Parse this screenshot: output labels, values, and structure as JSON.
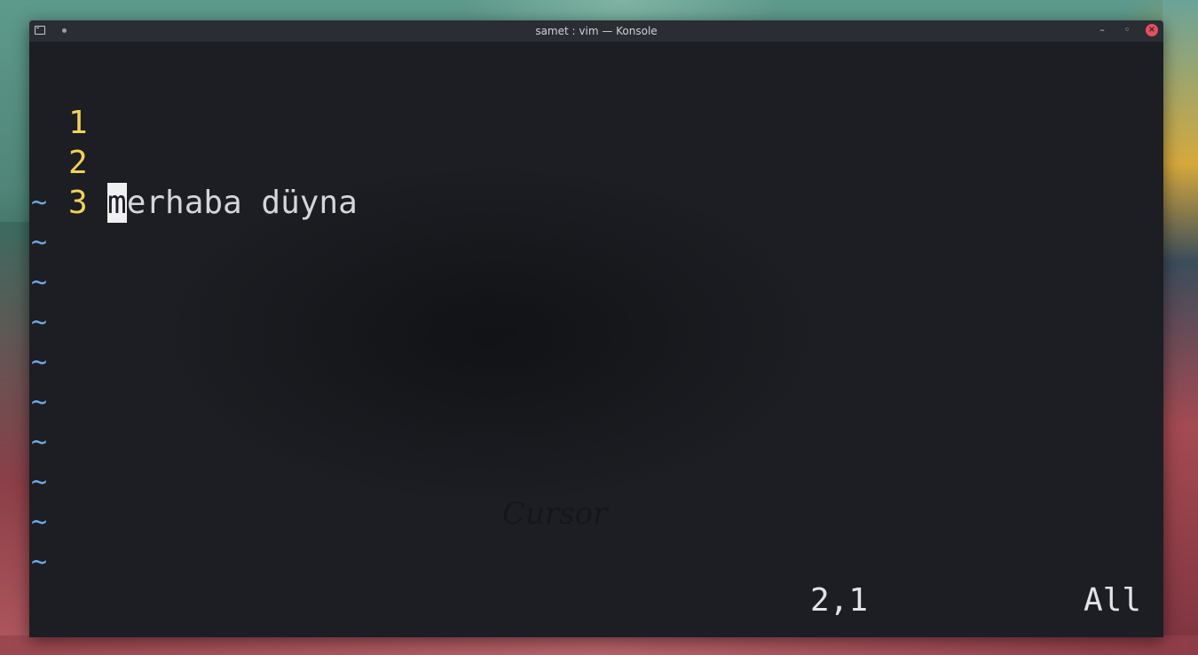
{
  "window": {
    "title": "samet : vim — Konsole",
    "controls": {
      "minimize": "–",
      "maximize": "◦",
      "close": "×"
    }
  },
  "editor": {
    "lines": [
      {
        "number": "1",
        "cursor_char": "",
        "text": ""
      },
      {
        "number": "2",
        "cursor_char": "m",
        "text": "erhaba düyna"
      },
      {
        "number": "3",
        "cursor_char": "",
        "text": ""
      }
    ],
    "tilde": "~",
    "tilde_count": 10,
    "cursor_position": "2,1",
    "scroll_indicator": "All"
  },
  "watermark": "Cursor",
  "colors": {
    "line_number": "#f2d15a",
    "tilde": "#6fa8e6",
    "text": "#d4d6d9",
    "background": "#1c1e23",
    "close_button": "#e5505b"
  }
}
